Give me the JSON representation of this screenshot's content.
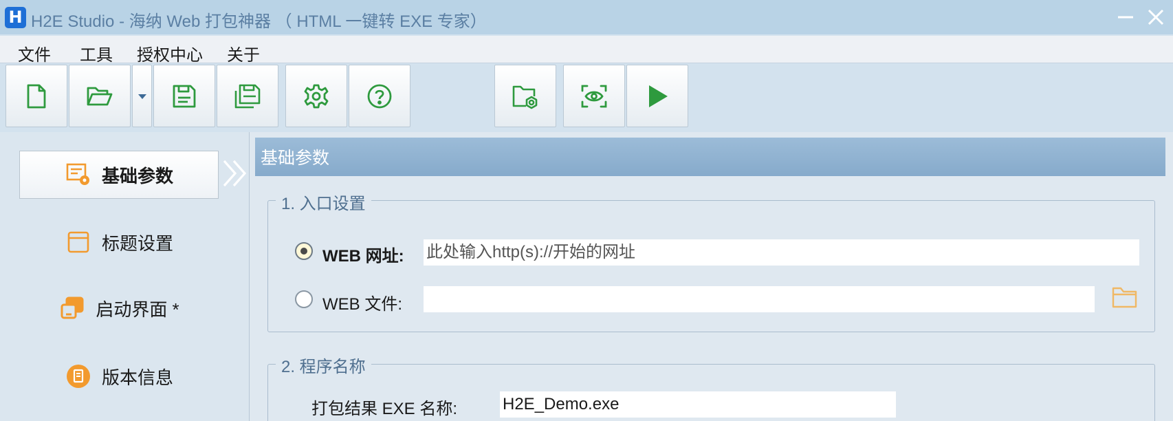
{
  "window": {
    "logo_letter": "H",
    "title": "H2E Studio - 海纳 Web 打包神器 （ HTML 一键转 EXE 专家）"
  },
  "menu": {
    "items": [
      {
        "label": "文件"
      },
      {
        "label": "工具"
      },
      {
        "label": "授权中心"
      },
      {
        "label": "关于"
      }
    ]
  },
  "toolbar": {
    "icons": [
      "new-file-icon",
      "open-folder-icon",
      "dropdown-arrow-icon",
      "save-icon",
      "save-as-icon",
      "settings-gear-icon",
      "help-icon",
      "output-folder-icon",
      "preview-eye-icon",
      "run-play-icon"
    ]
  },
  "nav": {
    "items": [
      {
        "label": "基础参数",
        "active": true
      },
      {
        "label": "标题设置"
      },
      {
        "label": "启动界面 *"
      },
      {
        "label": "版本信息"
      }
    ]
  },
  "main": {
    "section_title": "基础参数",
    "group1": {
      "legend": "1. 入口设置",
      "web_url_label": "WEB 网址:",
      "web_url_placeholder": "此处输入http(s)://开始的网址",
      "web_file_label": "WEB 文件:",
      "web_file_value": ""
    },
    "group2": {
      "legend": "2. 程序名称",
      "exe_name_label": "打包结果 EXE 名称:",
      "exe_name_value": "H2E_Demo.exe"
    }
  },
  "colors": {
    "accent_green": "#2e9a3e",
    "accent_orange": "#f29a2e",
    "header_blue": "#86aacb"
  }
}
